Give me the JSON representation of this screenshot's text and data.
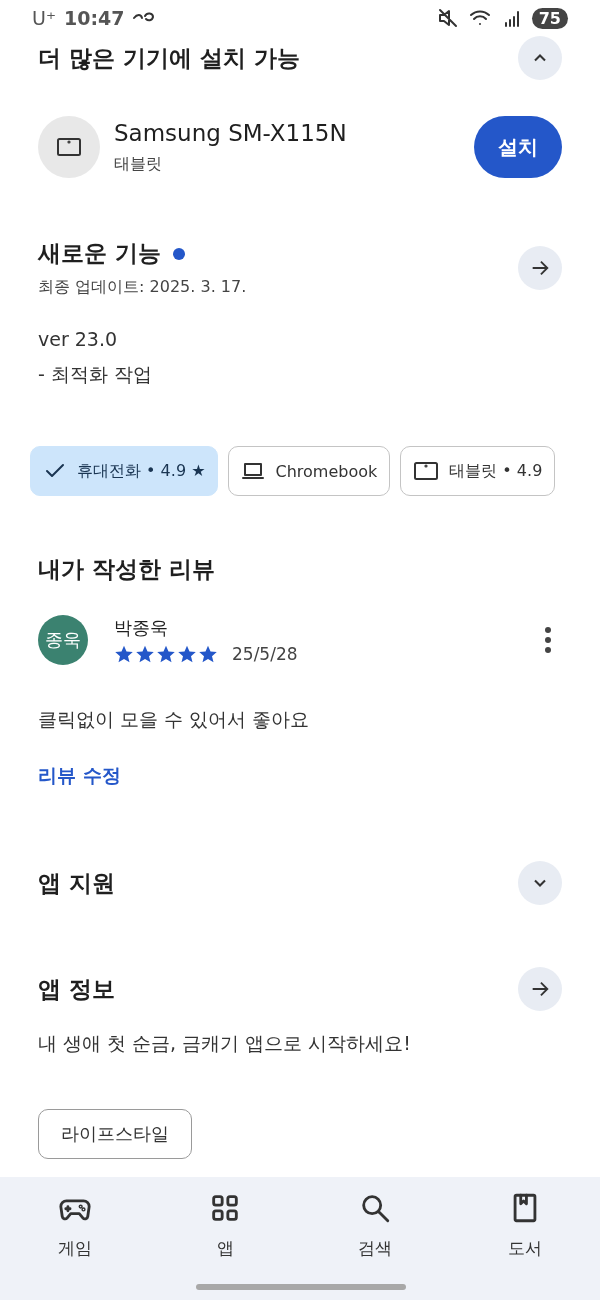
{
  "status_bar": {
    "carrier": "U⁺",
    "time": "10:47",
    "battery": "75"
  },
  "install_section": {
    "title": "더 많은 기기에 설치 가능",
    "expanded": true,
    "device": {
      "name": "Samsung SM-X115N",
      "type": "태블릿",
      "button": "설치"
    }
  },
  "whats_new": {
    "title": "새로운 기능",
    "unread": true,
    "updated": "최종 업데이트: 2025. 3. 17.",
    "lines": [
      "ver 23.0",
      "- 최적화 작업"
    ]
  },
  "device_chips": [
    {
      "kind": "phone",
      "label": "휴대전화 • 4.9 ★",
      "selected": true
    },
    {
      "kind": "laptop",
      "label": "Chromebook",
      "selected": false
    },
    {
      "kind": "tablet",
      "label": "태블릿 • 4.9",
      "selected": false
    }
  ],
  "my_review": {
    "title": "내가 작성한 리뷰",
    "avatar": "종욱",
    "author": "박종욱",
    "stars": 5,
    "date": "25/5/28",
    "text": "클릭없이 모을 수 있어서 좋아요",
    "edit_link": "리뷰 수정"
  },
  "app_support": {
    "title": "앱 지원",
    "expanded": false
  },
  "app_info": {
    "title": "앱 정보",
    "description": "내 생애 첫 순금, 금캐기 앱으로 시작하세요!",
    "tag": "라이프스타일"
  },
  "bottom_nav": [
    {
      "kind": "games",
      "label": "게임"
    },
    {
      "kind": "apps",
      "label": "앱"
    },
    {
      "kind": "search",
      "label": "검색"
    },
    {
      "kind": "books",
      "label": "도서"
    }
  ]
}
